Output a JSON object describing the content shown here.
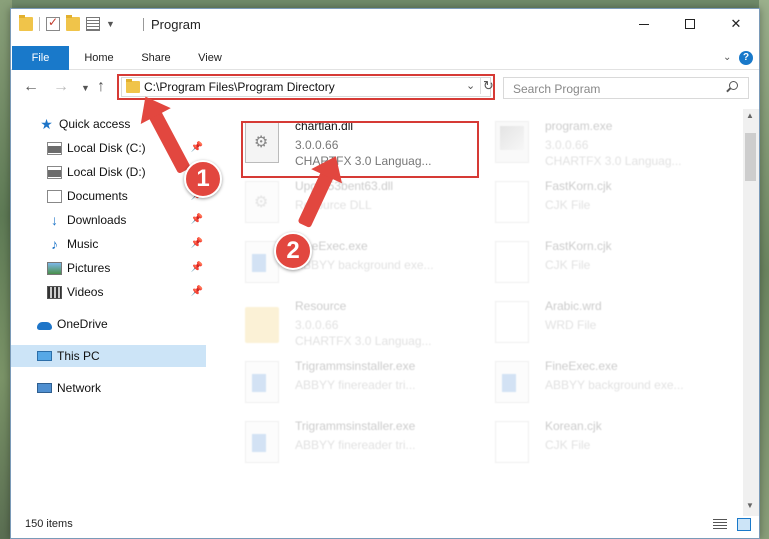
{
  "window": {
    "title": "Program",
    "minimize": "—",
    "close": "✕"
  },
  "ribbon": {
    "tabs": [
      "File",
      "Home",
      "Share",
      "View"
    ],
    "help": "?"
  },
  "address": {
    "path": "C:\\Program Files\\Program Directory",
    "search_placeholder": "Search Program"
  },
  "sidebar": {
    "items": [
      {
        "label": "Quick access",
        "icon": "star-icon"
      },
      {
        "label": "Local Disk (C:)",
        "icon": "disk-icon"
      },
      {
        "label": "Local Disk (D:)",
        "icon": "disk-icon"
      },
      {
        "label": "Documents",
        "icon": "documents-icon"
      },
      {
        "label": "Downloads",
        "icon": "downloads-icon"
      },
      {
        "label": "Music",
        "icon": "music-icon"
      },
      {
        "label": "Pictures",
        "icon": "pictures-icon"
      },
      {
        "label": "Videos",
        "icon": "videos-icon"
      },
      {
        "label": "OneDrive",
        "icon": "onedrive-icon"
      },
      {
        "label": "This PC",
        "icon": "this-pc-icon"
      },
      {
        "label": "Network",
        "icon": "network-icon"
      }
    ]
  },
  "files": [
    {
      "name": "chartlan.dll",
      "line1": "3.0.0.66",
      "line2": "CHARTFX 3.0 Languag...",
      "icon": "dll-icon"
    },
    {
      "name": "program.exe",
      "line1": "3.0.0.66",
      "line2": "CHARTFX 3.0 Languag...",
      "icon": "exe-icon"
    },
    {
      "name": "Upgrd53bent63.dll",
      "line1": "Resource DLL",
      "line2": "",
      "icon": "dll-icon"
    },
    {
      "name": "FastKorn.cjk",
      "line1": "CJK File",
      "line2": "",
      "icon": "file-icon"
    },
    {
      "name": "FineExec.exe",
      "line1": "ABBYY background exe...",
      "line2": "",
      "icon": "exe-icon"
    },
    {
      "name": "FastKorn.cjk",
      "line1": "CJK File",
      "line2": "",
      "icon": "file-icon"
    },
    {
      "name": "Resource",
      "line1": "3.0.0.66",
      "line2": "CHARTFX 3.0 Languag...",
      "icon": "folder-icon"
    },
    {
      "name": "Arabic.wrd",
      "line1": "WRD File",
      "line2": "",
      "icon": "file-icon"
    },
    {
      "name": "Trigrammsinstaller.exe",
      "line1": "ABBYY finereader tri...",
      "line2": "",
      "icon": "exe-icon"
    },
    {
      "name": "FineExec.exe",
      "line1": "ABBYY background exe...",
      "line2": "",
      "icon": "exe-icon"
    },
    {
      "name": "Trigrammsinstaller.exe",
      "line1": "ABBYY finereader tri...",
      "line2": "",
      "icon": "exe-icon"
    },
    {
      "name": "Korean.cjk",
      "line1": "CJK File",
      "line2": "",
      "icon": "file-icon"
    }
  ],
  "status": {
    "count": "150 items"
  },
  "annotations": {
    "step1": "1",
    "step2": "2",
    "color": "#e2473f"
  }
}
